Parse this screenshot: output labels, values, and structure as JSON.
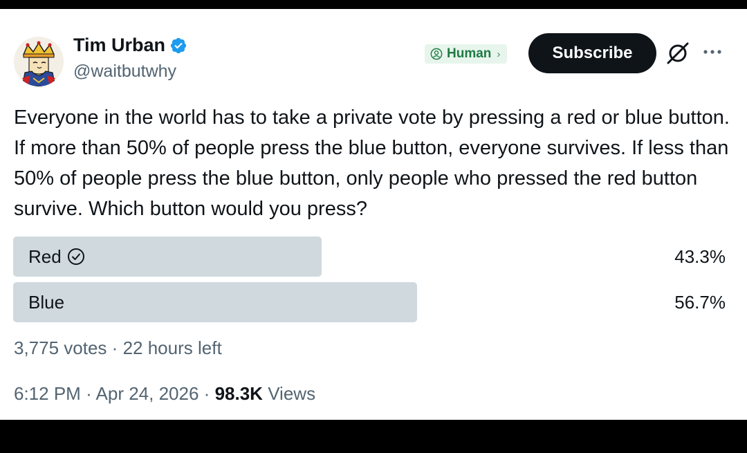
{
  "author": {
    "display_name": "Tim Urban",
    "handle": "@waitbutwhy"
  },
  "header": {
    "human_badge_label": "Human",
    "subscribe_label": "Subscribe"
  },
  "tweet": {
    "text": "Everyone in the world has to take a private vote by pressing a red or blue button. If more than 50% of people press the blue button, everyone survives. If less than 50% of people press the blue button, only people who pressed the red button survive. Which button would you press?"
  },
  "poll": {
    "options": [
      {
        "label": "Red",
        "percent_label": "43.3%",
        "percent": 43.3,
        "selected": true
      },
      {
        "label": "Blue",
        "percent_label": "56.7%",
        "percent": 56.7,
        "selected": false
      }
    ],
    "votes": "3,775 votes",
    "separator": "·",
    "time_left": "22 hours left"
  },
  "meta": {
    "time": "6:12 PM",
    "separator": "·",
    "date": "Apr 24, 2026",
    "views_count": "98.3K",
    "views_label": "Views"
  },
  "icons": {
    "verified": "verified-badge-icon",
    "human": "human-badge-icon",
    "grok": "grok-icon",
    "more": "more-icon",
    "check": "check-circle-icon"
  },
  "colors": {
    "verified_blue": "#1d9bf0",
    "poll_bar": "#cfd9de",
    "human_badge_bg": "#e7f5ec",
    "human_badge_text": "#1f7a44"
  }
}
